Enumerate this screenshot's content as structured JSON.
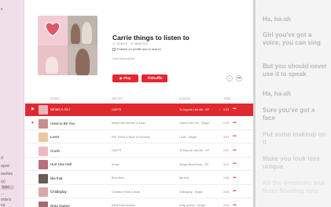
{
  "sidebar": {
    "items": [
      "s",
      "d",
      "ayed",
      "ourites",
      "(s)",
      "less...",
      "...",
      "orite's",
      "es"
    ]
  },
  "playlist": {
    "title": "Carrie things to listen to",
    "meta": "17 SONGS · 37 MINUTES",
    "publish_label": "Publish on profile and in search",
    "add_description": "Add Description",
    "play_label": "▶ Play",
    "shuffle_label": "⤨ Shuffle",
    "download_icon": "↓",
    "more_icon": "•••"
  },
  "table": {
    "headers": {
      "song": "SONG",
      "artist": "ARTIST",
      "album": "ALBUM",
      "time": "TIME"
    },
    "rows": [
      {
        "lead": "▶",
        "song": "Whats A Girl",
        "artist": "CARYS",
        "album": "To Anyone Like Me - EP",
        "download": "↓",
        "time": "3:33",
        "more": "•••",
        "thumb": "#e9b4be"
      },
      {
        "lead": "♥",
        "song": "Used to Be You",
        "artist": "Molly Kate Kestner & Arcia",
        "album": "Used to Be You - Single",
        "download": "",
        "time": "2:49",
        "more": "•••",
        "thumb": "#c98f8d"
      },
      {
        "lead": "",
        "song": "Lover",
        "artist": "Pier Trevel & Ryan & Kennedy",
        "album": "Lover - Single",
        "download": "",
        "time": "3:03",
        "more": "•••",
        "thumb": "#e7c9a6"
      },
      {
        "lead": "",
        "song": "Crush",
        "artist": "CARYS",
        "album": "To Anyone Like Me - EP",
        "download": "",
        "time": "2:47",
        "more": "•••",
        "thumb": "#ecb8c3"
      },
      {
        "lead": "",
        "song": "Hurt Like Hell",
        "artist": "Arrica",
        "album": "Songs About Boys - EP",
        "download": "",
        "time": "3:27",
        "more": "•••",
        "thumb": "#b86f7b"
      },
      {
        "lead": "",
        "song": "like that",
        "artist": "Bea Miller",
        "album": "like that",
        "download": "",
        "time": "3:08",
        "more": "•••",
        "thumb": "#6b5a52"
      },
      {
        "lead": "",
        "song": "Childsplay",
        "artist": "Christina Reidl & Arcia",
        "album": "Childsplay - Single",
        "download": "",
        "time": "3:19",
        "more": "•••",
        "thumb": "#d8a7a9"
      },
      {
        "lead": "",
        "song": "Drag Queen",
        "artist": "Molly Kate Kestner",
        "album": "Drag Queen - Single",
        "download": "",
        "time": "3:15",
        "more": "•••",
        "thumb": "#a46b72"
      }
    ]
  },
  "lyrics": [
    "Ha, ha-ah",
    "Girl you've got a voice, you can sing",
    "But you should never use it to speak",
    "Ha, ha-ah",
    "Sure you've got a face",
    "Put some makeup on it",
    "Make you look less unique",
    "All the emotions and fears flooding over"
  ],
  "colors": {
    "accent": "#e6262f",
    "sidebar_bg": "#f0dfe8",
    "lyrics_bg": "#f4f4f4"
  }
}
